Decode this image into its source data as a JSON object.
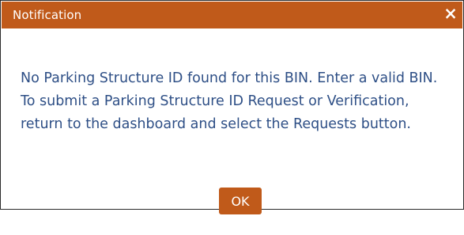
{
  "dialog": {
    "title": "Notification",
    "close_glyph": "×",
    "message": "No Parking Structure ID found for this BIN. Enter a valid BIN. To submit a Parking Structure ID Request or Verification, return to the dashboard and select the Requests button.",
    "ok_label": "OK"
  },
  "colors": {
    "title_bar": "#c05a1a",
    "message_text": "#2e4f86",
    "button": "#c05a1a"
  },
  "icons": {
    "close": "close-icon"
  }
}
